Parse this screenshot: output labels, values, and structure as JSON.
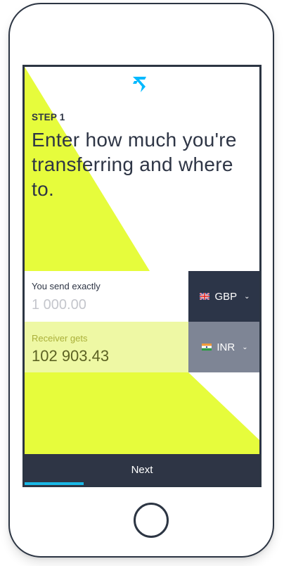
{
  "brand": {
    "logo_icon": "transferwise-flag-icon",
    "accent_color": "#00b9ff",
    "highlight_color": "#e6fc3c",
    "dark_color": "#2e3545"
  },
  "step": {
    "label": "STEP 1",
    "headline": "Enter how much you're transferring and where to."
  },
  "send": {
    "label": "You send exactly",
    "placeholder": "1 000.00",
    "currency": {
      "code": "GBP",
      "flag_icon": "uk-flag-icon",
      "chevron_icon": "chevron-down-icon"
    }
  },
  "receive": {
    "label": "Receiver gets",
    "value": "102 903.43",
    "currency": {
      "code": "INR",
      "flag_icon": "india-flag-icon",
      "chevron_icon": "chevron-down-icon"
    }
  },
  "footer": {
    "next_label": "Next",
    "progress_fraction": 0.25
  }
}
